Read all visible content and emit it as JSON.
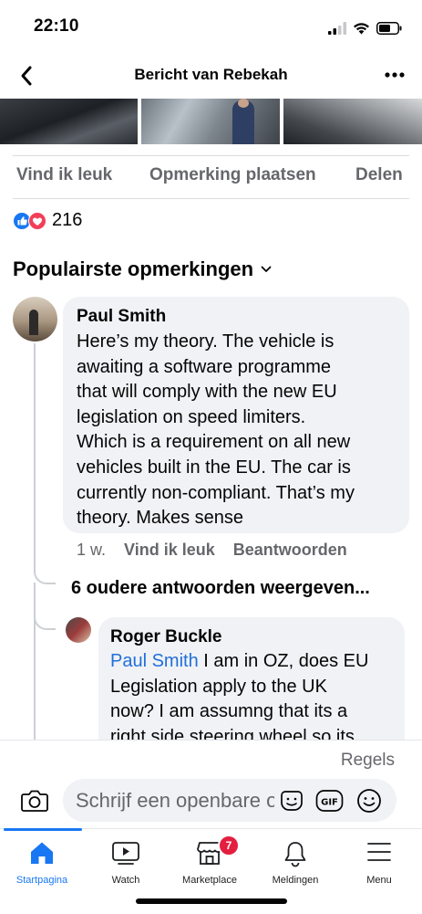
{
  "status_bar": {
    "time": "22:10"
  },
  "header": {
    "title": "Bericht van Rebekah"
  },
  "post_actions": {
    "like": "Vind ik leuk",
    "comment": "Opmerking plaatsen",
    "share": "Delen"
  },
  "reactions": {
    "count": "216"
  },
  "comments_section": {
    "title": "Populairste opmerkingen"
  },
  "comment": {
    "author": "Paul Smith",
    "text_lines": [
      "Here’s my theory. The vehicle is",
      "awaiting a software programme",
      "that will comply with the new EU",
      "legislation on speed limiters.",
      "Which is a requirement on all new",
      "vehicles built in the EU. The car is",
      "currently non-compliant. That’s my",
      "theory. Makes sense"
    ],
    "time": "1 w.",
    "like_label": "Vind ik leuk",
    "reply_label": "Beantwoorden"
  },
  "older_replies": "6 oudere antwoorden weergeven...",
  "reply": {
    "author": "Roger Buckle",
    "mention": "Paul Smith",
    "text_lines": [
      " I am in OZ, does EU",
      "Legislation apply to the UK",
      "now?  I am assumng that its a",
      "right side steering wheel so its"
    ]
  },
  "composer": {
    "rules": "Regels",
    "placeholder": "Schrijf een openbare opmerking..."
  },
  "tabs": [
    {
      "label": "Startpagina",
      "icon": "home-icon"
    },
    {
      "label": "Watch",
      "icon": "watch-icon"
    },
    {
      "label": "Marketplace",
      "icon": "marketplace-icon",
      "badge": "7"
    },
    {
      "label": "Meldingen",
      "icon": "bell-icon"
    },
    {
      "label": "Menu",
      "icon": "menu-icon"
    }
  ],
  "colors": {
    "accent": "#1877f2",
    "badge": "#e41e3f",
    "bubble": "#f0f2f5",
    "mention": "#216fdb"
  }
}
